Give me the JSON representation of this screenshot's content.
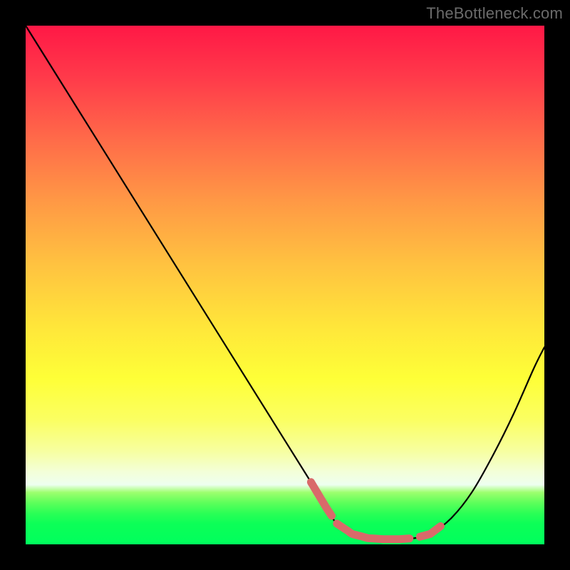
{
  "watermark": "TheBottleneck.com",
  "colors": {
    "frame": "#000000",
    "curve": "#000000",
    "highlight": "#d96a6a",
    "grad_top": "#ff1846",
    "grad_bottom": "#00ff5d"
  },
  "chart_data": {
    "type": "line",
    "title": "",
    "xlabel": "",
    "ylabel": "",
    "xlim": [
      0,
      100
    ],
    "ylim": [
      0,
      100
    ],
    "grid": false,
    "series": [
      {
        "name": "bottleneck-curve",
        "x": [
          0,
          5,
          10,
          15,
          20,
          25,
          30,
          35,
          40,
          45,
          50,
          55,
          58,
          60,
          63,
          66,
          69,
          72,
          75,
          78,
          82,
          86,
          90,
          94,
          98,
          100
        ],
        "values": [
          100,
          92,
          84,
          76,
          68,
          60,
          52,
          44,
          36,
          28,
          20,
          12,
          7,
          4,
          2,
          1.2,
          1,
          1,
          1.2,
          2,
          5,
          10,
          17,
          25,
          34,
          38
        ]
      }
    ],
    "highlight_segments": [
      {
        "x0": 55,
        "x1": 59
      },
      {
        "x0": 60,
        "x1": 74
      },
      {
        "x0": 76,
        "x1": 80
      }
    ]
  }
}
